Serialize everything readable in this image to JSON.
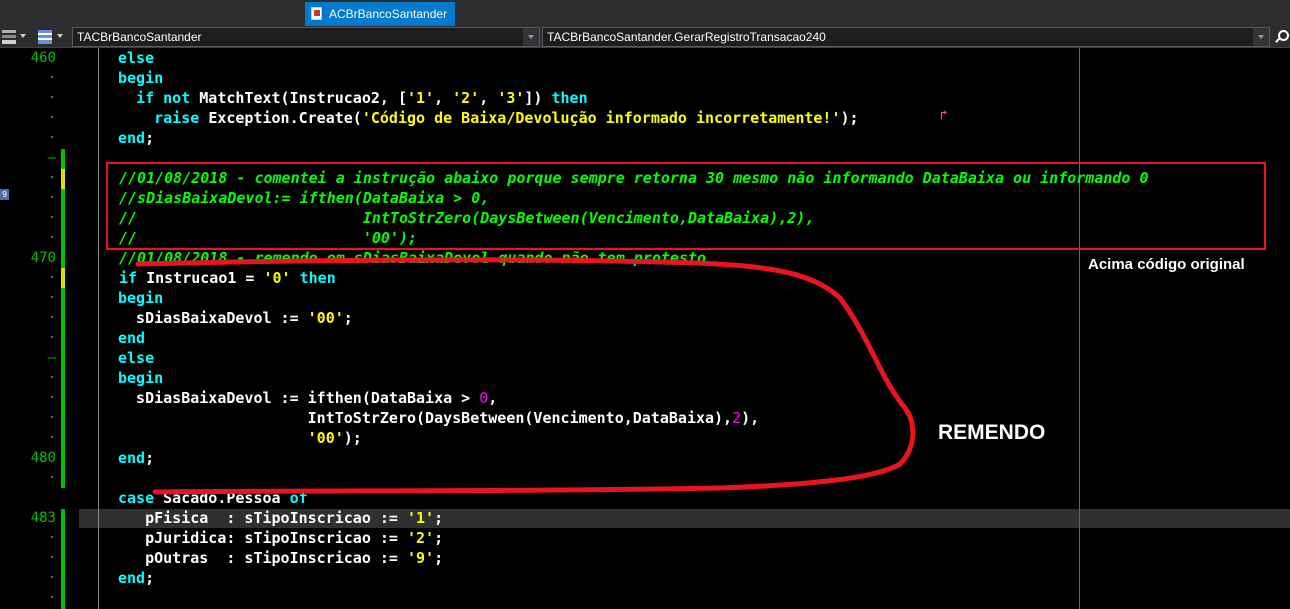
{
  "tabs": {
    "active_label": "ACBrBancoSantander"
  },
  "toolbar": {
    "class_combo": "TACBrBancoSantander",
    "method_combo": "TACBrBancoSantander.GerarRegistroTransacao240"
  },
  "gutter": {
    "line_numbers": [
      "460",
      "470",
      "480",
      "483"
    ],
    "bookmark": "9"
  },
  "annotations": {
    "original_label": "Acima código original",
    "remendo_label": "REMENDO"
  },
  "colors": {
    "annotation_red": "#e8141e",
    "accent": "#007acc"
  },
  "code_lines": [
    [
      {
        "c": "kw",
        "t": "else"
      }
    ],
    [
      {
        "c": "kw",
        "t": "begin"
      }
    ],
    [
      {
        "c": "kw",
        "t": "  if not "
      },
      {
        "c": "id",
        "t": "MatchText(Instrucao2, ["
      },
      {
        "c": "str",
        "t": "'1'"
      },
      {
        "c": "id",
        "t": ", "
      },
      {
        "c": "str",
        "t": "'2'"
      },
      {
        "c": "id",
        "t": ", "
      },
      {
        "c": "str",
        "t": "'3'"
      },
      {
        "c": "id",
        "t": "]) "
      },
      {
        "c": "kw",
        "t": "then"
      }
    ],
    [
      {
        "c": "kw",
        "t": "    raise "
      },
      {
        "c": "id",
        "t": "Exception.Create("
      },
      {
        "c": "str",
        "t": "'Código de Baixa/Devolução informado incorretamente!'"
      },
      {
        "c": "id",
        "t": ");"
      }
    ],
    [
      {
        "c": "kw",
        "t": "end"
      },
      {
        "c": "id",
        "t": ";"
      }
    ],
    [],
    [
      {
        "c": "cmt",
        "t": "//01/08/2018 - comentei a instrução abaixo porque sempre retorna 30 mesmo não informando DataBaixa ou informando 0"
      }
    ],
    [
      {
        "c": "cmt",
        "t": "//sDiasBaixaDevol:= ifthen(DataBaixa > 0,"
      }
    ],
    [
      {
        "c": "cmt",
        "t": "//                         IntToStrZero(DaysBetween(Vencimento,DataBaixa),2),"
      }
    ],
    [
      {
        "c": "cmt",
        "t": "//                         '00');"
      }
    ],
    [
      {
        "c": "cmt",
        "t": "//01/08/2018 - remendo em sDiasBaixaDevol quando não tem protesto"
      }
    ],
    [
      {
        "c": "kw",
        "t": "if "
      },
      {
        "c": "id",
        "t": "Instrucao1 = "
      },
      {
        "c": "str",
        "t": "'0'"
      },
      {
        "c": "kw",
        "t": " then"
      }
    ],
    [
      {
        "c": "kw",
        "t": "begin"
      }
    ],
    [
      {
        "c": "id",
        "t": "  sDiasBaixaDevol := "
      },
      {
        "c": "str",
        "t": "'00'"
      },
      {
        "c": "id",
        "t": ";"
      }
    ],
    [
      {
        "c": "kw",
        "t": "end"
      }
    ],
    [
      {
        "c": "kw",
        "t": "else"
      }
    ],
    [
      {
        "c": "kw",
        "t": "begin"
      }
    ],
    [
      {
        "c": "id",
        "t": "  sDiasBaixaDevol := ifthen(DataBaixa > "
      },
      {
        "c": "num",
        "t": "0"
      },
      {
        "c": "id",
        "t": ","
      }
    ],
    [
      {
        "c": "id",
        "t": "                     IntToStrZero(DaysBetween(Vencimento,DataBaixa),"
      },
      {
        "c": "num",
        "t": "2"
      },
      {
        "c": "id",
        "t": "),"
      }
    ],
    [
      {
        "c": "str",
        "t": "                     '00'"
      },
      {
        "c": "id",
        "t": ");"
      }
    ],
    [
      {
        "c": "kw",
        "t": "end"
      },
      {
        "c": "id",
        "t": ";"
      }
    ],
    [],
    [
      {
        "c": "kw",
        "t": "case "
      },
      {
        "c": "id",
        "t": "Sacado.Pessoa "
      },
      {
        "c": "kw",
        "t": "of"
      }
    ],
    [
      {
        "c": "id",
        "t": "   pFisica  : sTipoInscricao := "
      },
      {
        "c": "str",
        "t": "'1'"
      },
      {
        "c": "id",
        "t": ";"
      }
    ],
    [
      {
        "c": "id",
        "t": "   pJuridica: sTipoInscricao := "
      },
      {
        "c": "str",
        "t": "'2'"
      },
      {
        "c": "id",
        "t": ";"
      }
    ],
    [
      {
        "c": "id",
        "t": "   pOutras  : sTipoInscricao := "
      },
      {
        "c": "str",
        "t": "'9'"
      },
      {
        "c": "id",
        "t": ";"
      }
    ],
    [
      {
        "c": "kw",
        "t": "end"
      },
      {
        "c": "id",
        "t": ";"
      }
    ]
  ]
}
